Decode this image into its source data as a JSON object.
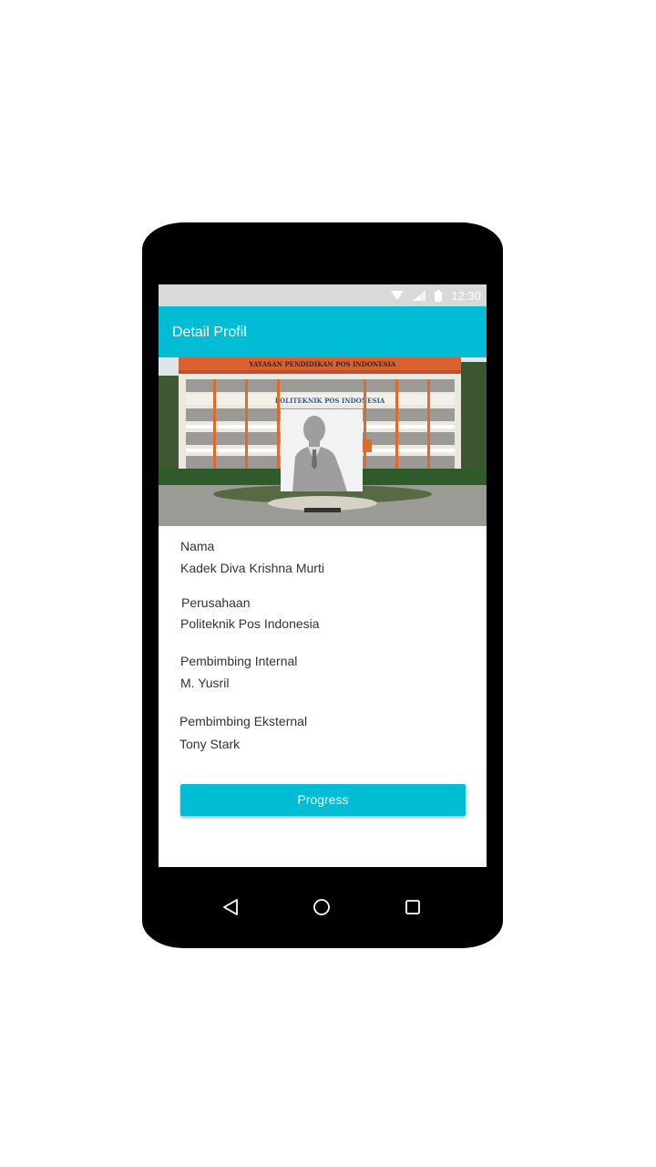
{
  "status_bar": {
    "time": "12:30"
  },
  "appbar": {
    "title": "Detail Profil"
  },
  "hero": {
    "building_banner": "YAYASAN PENDIDIKAN        POS INDONESIA",
    "building_sign": "POLITEKNIK POS INDONESIA"
  },
  "profile": {
    "fields": [
      {
        "label": "Nama",
        "value": "Kadek Diva Krishna Murti"
      },
      {
        "label": "Perusahaan",
        "value": "Politeknik Pos Indonesia"
      },
      {
        "label": "Pembimbing Internal",
        "value": "M. Yusril"
      },
      {
        "label": "Pembimbing Eksternal",
        "value": "Tony Stark"
      }
    ]
  },
  "actions": {
    "progress_label": "Progress"
  },
  "colors": {
    "accent": "#00bcd4",
    "status_bar": "#d9d9d9"
  },
  "icons": [
    "wifi-icon",
    "signal-icon",
    "battery-icon",
    "back-icon",
    "home-icon",
    "recents-icon",
    "avatar-placeholder-icon"
  ]
}
